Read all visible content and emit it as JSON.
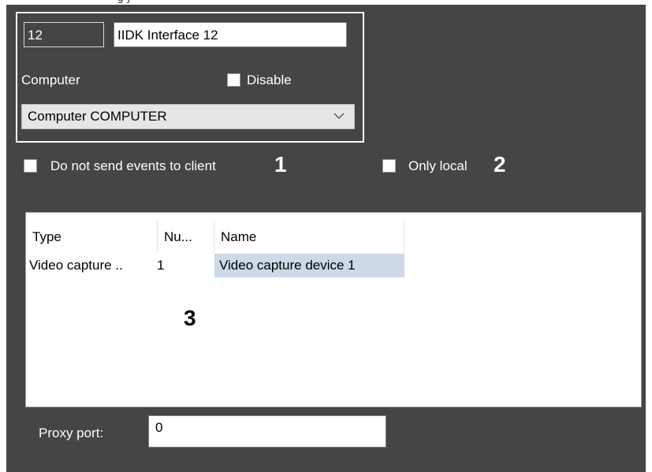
{
  "top_partial_text": "g                                                          j",
  "interface": {
    "id_value": "12",
    "name_value": "IIDK Interface 12",
    "computer_label": "Computer",
    "disable_label": "Disable",
    "computer_select": "Computer COMPUTER"
  },
  "options": {
    "no_send_events_label": "Do not send events to client",
    "no_send_events_marker": "1",
    "only_local_label": "Only local",
    "only_local_marker": "2"
  },
  "table": {
    "columns": [
      "Type",
      "Nu...",
      "Name"
    ],
    "rows": [
      {
        "type": "Video capture ..",
        "number": "1",
        "name": "Video capture device 1"
      }
    ],
    "marker": "3"
  },
  "proxy": {
    "label": "Proxy port:",
    "value": "0"
  },
  "colors": {
    "panel_bg": "#454545",
    "selected_cell": "#cdd9e6"
  },
  "icons": {
    "select_arrow": "chevron-down-icon"
  }
}
